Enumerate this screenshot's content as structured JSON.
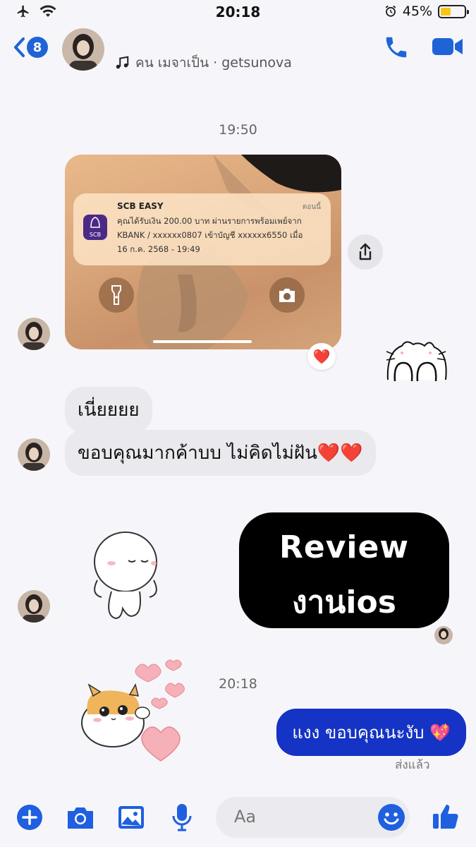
{
  "status_bar": {
    "time": "20:18",
    "battery_percent": "45%",
    "battery_level": 0.45,
    "icons": [
      "airplane-icon",
      "wifi-icon",
      "alarm-icon",
      "battery-icon"
    ]
  },
  "header": {
    "unread_count": "8",
    "now_playing": "คน เมจาเป็น · getsunova",
    "icons": [
      "back-chevron-icon",
      "music-note-icon",
      "phone-icon",
      "video-icon"
    ]
  },
  "chat": {
    "timestamp_1": "19:50",
    "notification": {
      "app": "SCB EASY",
      "when": "ตอนนี้",
      "line1": "คุณได้รับเงิน 200.00 บาท ผ่านรายการพร้อมเพย์จาก",
      "line2": "KBANK / xxxxxx0807 เข้าบัญชี xxxxxx6550 เมื่อ",
      "line3": "16 ก.ค. 2568 - 19:49",
      "icon_label": "SCB"
    },
    "reaction": "❤️",
    "msg_1": "เนี่ยยยย",
    "msg_2": "ขอบคุณมากค้าบบ ไม่คิดไม่ฝัน❤️❤️",
    "review_line1": "Review",
    "review_line2": "งานios",
    "timestamp_2": "20:18",
    "msg_out": "แงง ขอบคุณนะงับ 💖",
    "sent_status": "ส่งแล้ว"
  },
  "composer": {
    "placeholder": "Aa",
    "icons": [
      "plus-icon",
      "camera-icon",
      "gallery-icon",
      "microphone-icon",
      "emoji-icon",
      "thumbs-up-icon"
    ]
  },
  "colors": {
    "accent": "#1f64d7",
    "outgoing_bubble": "#1533c4",
    "incoming_bubble": "#e9e9ee",
    "battery": "#f5c518"
  }
}
